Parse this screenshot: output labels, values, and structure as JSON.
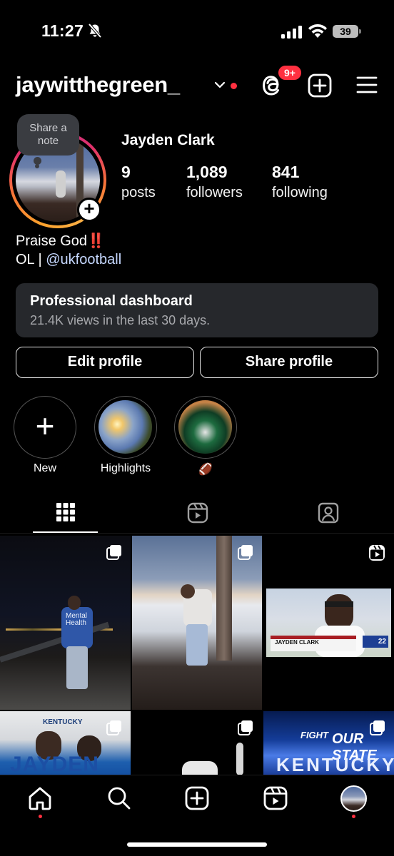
{
  "status_bar": {
    "time": "11:27",
    "battery": "39"
  },
  "header": {
    "username": "jaywitthegreen_",
    "threads_badge": "9+"
  },
  "profile": {
    "note_line1": "Share a",
    "note_line2": "note",
    "full_name": "Jayden Clark",
    "posts_count": "9",
    "posts_label": "posts",
    "followers_count": "1,089",
    "followers_label": "followers",
    "following_count": "841",
    "following_label": "following",
    "bio_line1": "Praise God‼️",
    "bio_line2_prefix": "OL | ",
    "bio_link": "@ukfootball"
  },
  "dashboard": {
    "title": "Professional dashboard",
    "subtitle": "21.4K views in the last 30 days."
  },
  "buttons": {
    "edit_profile": "Edit profile",
    "share_profile": "Share profile"
  },
  "highlights": [
    {
      "label": "New"
    },
    {
      "label": "Highlights"
    },
    {
      "label": "🏈"
    }
  ],
  "posts": {
    "post1_hoodie": "Mental Health",
    "post3_caption": "JAYDEN CLARK",
    "post3_score": "22",
    "post4_brand": "KENTUCKY",
    "post4_name": "JAYDEN",
    "post6_text1": "FIGHT",
    "post6_text2": "OUR STATE",
    "post6_text3": "KENTUCKY"
  },
  "colors": {
    "background": "#000000",
    "notification_red": "#ff3040",
    "link_blue": "#c6d8ff",
    "dashboard_bg": "#26282c"
  },
  "icons": {
    "status": [
      "bell-slash-icon",
      "cellular-signal-icon",
      "wifi-icon",
      "battery-icon"
    ],
    "header": [
      "chevron-down-icon",
      "threads-icon",
      "create-plus-icon",
      "hamburger-menu-icon"
    ],
    "tabs": [
      "grid-icon",
      "reels-icon",
      "tagged-person-icon"
    ],
    "nav": [
      "home-icon",
      "search-icon",
      "create-icon",
      "reels-icon",
      "profile-avatar"
    ]
  }
}
